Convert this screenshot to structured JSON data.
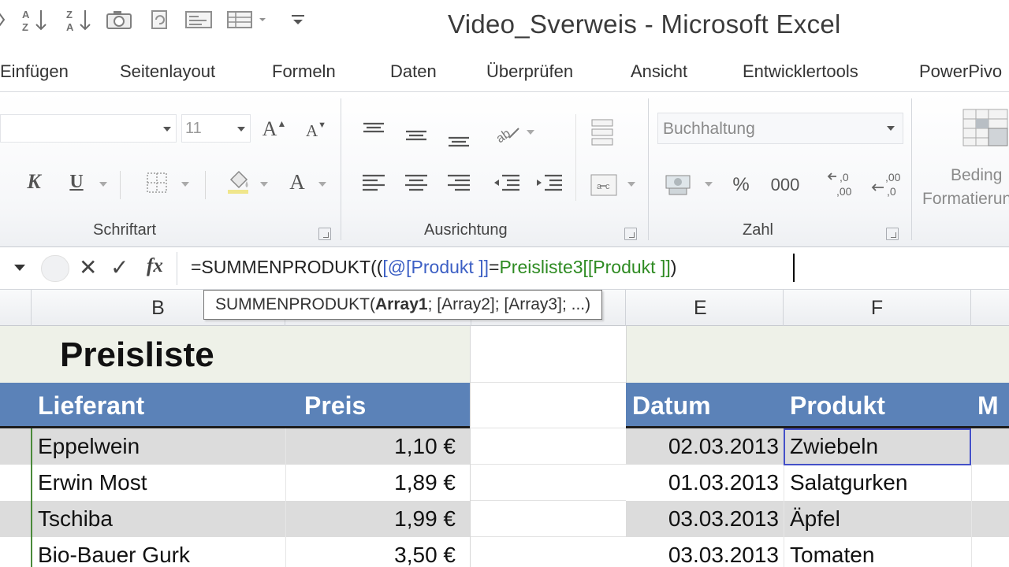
{
  "app": {
    "title": "Video_Sverweis  -  Microsoft Excel"
  },
  "ribbon": {
    "tabs": [
      "Einfügen",
      "Seitenlayout",
      "Formeln",
      "Daten",
      "Überprüfen",
      "Ansicht",
      "Entwicklertools",
      "PowerPivo"
    ],
    "font": {
      "size": "11",
      "italic_label": "K",
      "underline_label": "U",
      "grow_label": "A",
      "shrink_label": "A",
      "color_label": "A"
    },
    "groups": {
      "font": "Schriftart",
      "alignment": "Ausrichtung",
      "number": "Zahl"
    },
    "number": {
      "format": "Buchhaltung",
      "percent_label": "%",
      "thousands_label": "000"
    },
    "conditional": {
      "line1": "Beding",
      "line2": "Formatierung"
    }
  },
  "formula_bar": {
    "cancel_label": "✕",
    "enter_label": "✓",
    "fx_label": "fx",
    "formula": {
      "prefix": "=SUMMENPRODUKT((",
      "ref1": "[@[Produkt ]]",
      "eq": "=",
      "ref2": "Preisliste3[[Produkt ]]",
      "suffix": ")"
    },
    "tooltip": {
      "func": "SUMMENPRODUKT(",
      "arg1": "Array1",
      "rest": "; [Array2]; [Array3]; ...)"
    }
  },
  "columns": [
    "B",
    "E",
    "F"
  ],
  "sheet": {
    "title": "Preisliste",
    "left_table": {
      "headers": [
        "Lieferant",
        "Preis"
      ],
      "rows": [
        {
          "lieferant": "Eppelwein",
          "preis": "1,10 €"
        },
        {
          "lieferant": "Erwin Most",
          "preis": "1,89 €"
        },
        {
          "lieferant": "Tschiba",
          "preis": "1,99 €"
        },
        {
          "lieferant": "Bio-Bauer Gurk",
          "preis": "3,50 €"
        }
      ]
    },
    "right_table": {
      "headers": [
        "Datum",
        "Produkt",
        "M"
      ],
      "rows": [
        {
          "datum": "02.03.2013",
          "produkt": "Zwiebeln"
        },
        {
          "datum": "01.03.2013",
          "produkt": "Salatgurken"
        },
        {
          "datum": "03.03.2013",
          "produkt": "Äpfel"
        },
        {
          "datum": "03.03.2013",
          "produkt": "Tomaten"
        }
      ]
    }
  },
  "colors": {
    "table_header": "#5b82b8",
    "row_band": "#dcdcdc",
    "title_band": "#eef1e8",
    "formula_ref_blue": "#3c5fc4",
    "formula_ref_green": "#2e8b22",
    "active_cell_border": "#4450c8"
  }
}
